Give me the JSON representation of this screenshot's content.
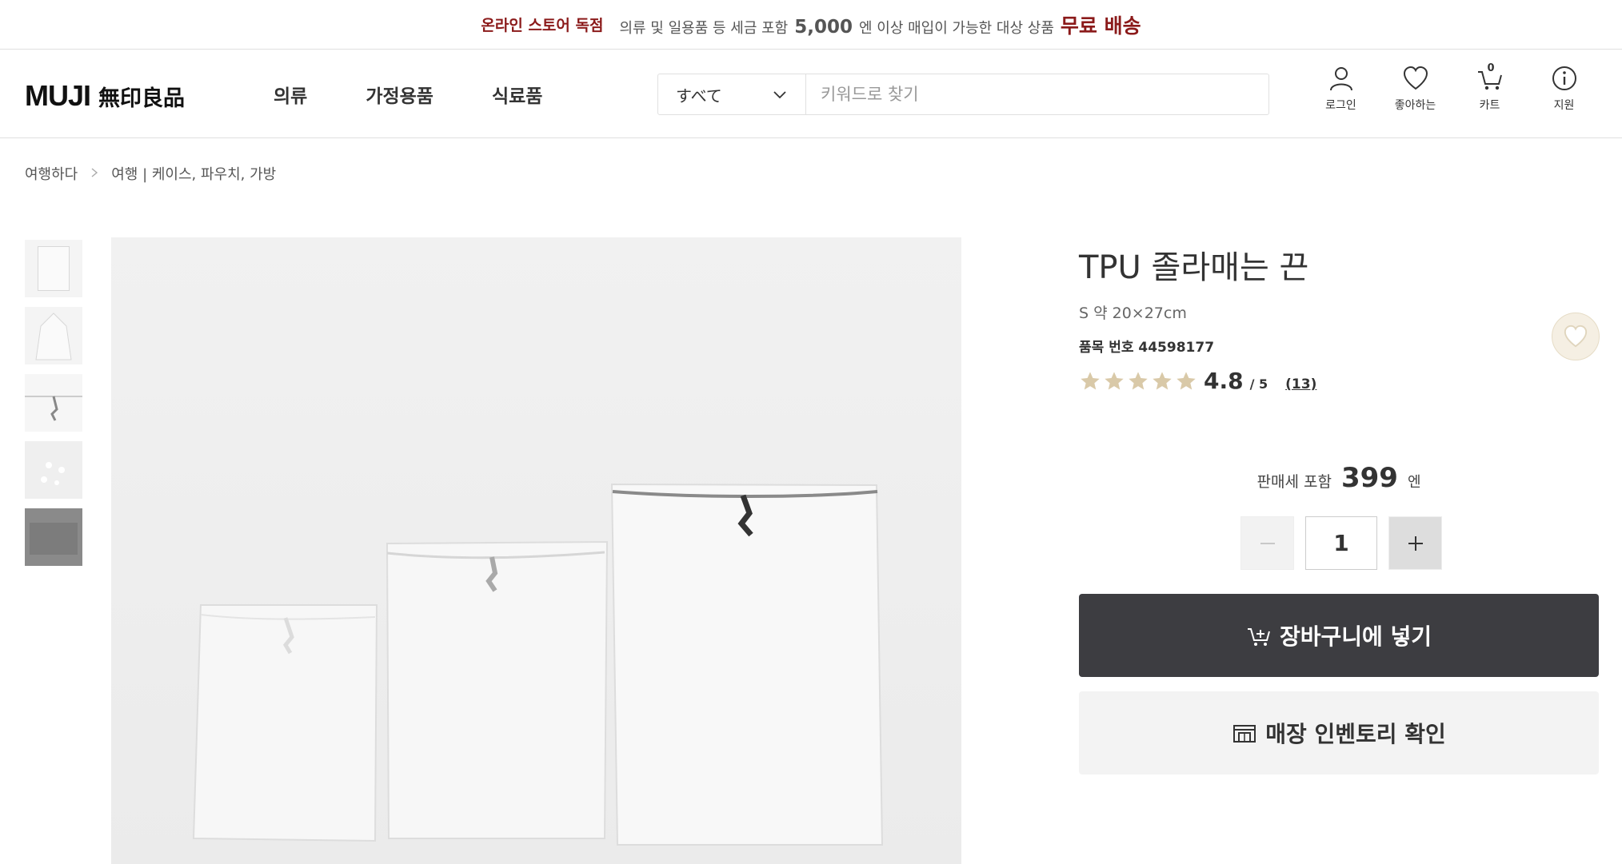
{
  "promo": {
    "exclusive": "온라인 스토어 독점",
    "message_prefix": "의류 및 일용품 등 세금 포함",
    "amount": "5,000",
    "message_suffix": "엔 이상 매입이 가능한 대상 상품",
    "free_shipping": "무료 배송",
    "accent_color": "#8b1a1a"
  },
  "header": {
    "logo_text": "MUJI",
    "logo_kanji": "無印良品",
    "nav": [
      "의류",
      "가정용품",
      "식료품"
    ],
    "search": {
      "category": "すべて",
      "placeholder": "키워드로 찾기"
    },
    "icons": {
      "login": "로그인",
      "favorites": "좋아하는",
      "cart": "카트",
      "cart_count": "0",
      "support": "지원"
    }
  },
  "breadcrumb": [
    "여행하다",
    "여행 | 케이스, 파우치, 가방"
  ],
  "product": {
    "title": "TPU 졸라매는 끈",
    "size": "S 약 20×27cm",
    "item_number_label": "품목 번호 44598177",
    "rating": 4.8,
    "rating_score": "4.8",
    "rating_outof": "/ 5",
    "review_count": "(13)",
    "star_color": "#d9c9a8",
    "price_tax_label": "판매세 포함",
    "price": "399",
    "currency": "엔",
    "quantity": "1",
    "add_to_cart": "장바구니에 넣기",
    "check_inventory": "매장 인벤토리 확인"
  }
}
